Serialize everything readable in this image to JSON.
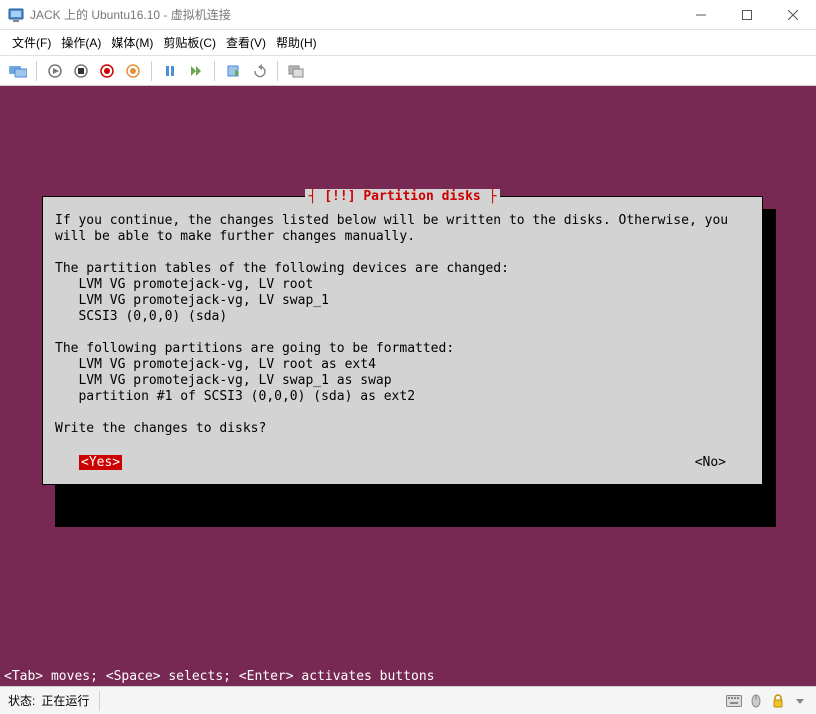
{
  "titlebar": {
    "text": "JACK 上的 Ubuntu16.10 - 虚拟机连接"
  },
  "menu": {
    "file": "文件(F)",
    "action": "操作(A)",
    "media": "媒体(M)",
    "clipboard": "剪贴板(C)",
    "view": "查看(V)",
    "help": "帮助(H)"
  },
  "dialog": {
    "title": "[!!] Partition disks",
    "body": "If you continue, the changes listed below will be written to the disks. Otherwise, you\nwill be able to make further changes manually.\n\nThe partition tables of the following devices are changed:\n   LVM VG promotejack-vg, LV root\n   LVM VG promotejack-vg, LV swap_1\n   SCSI3 (0,0,0) (sda)\n\nThe following partitions are going to be formatted:\n   LVM VG promotejack-vg, LV root as ext4\n   LVM VG promotejack-vg, LV swap_1 as swap\n   partition #1 of SCSI3 (0,0,0) (sda) as ext2\n\nWrite the changes to disks?",
    "yes": "<Yes>",
    "no": "<No>"
  },
  "hint": "<Tab> moves; <Space> selects; <Enter> activates buttons",
  "status": {
    "label": "状态:",
    "value": "正在运行"
  }
}
